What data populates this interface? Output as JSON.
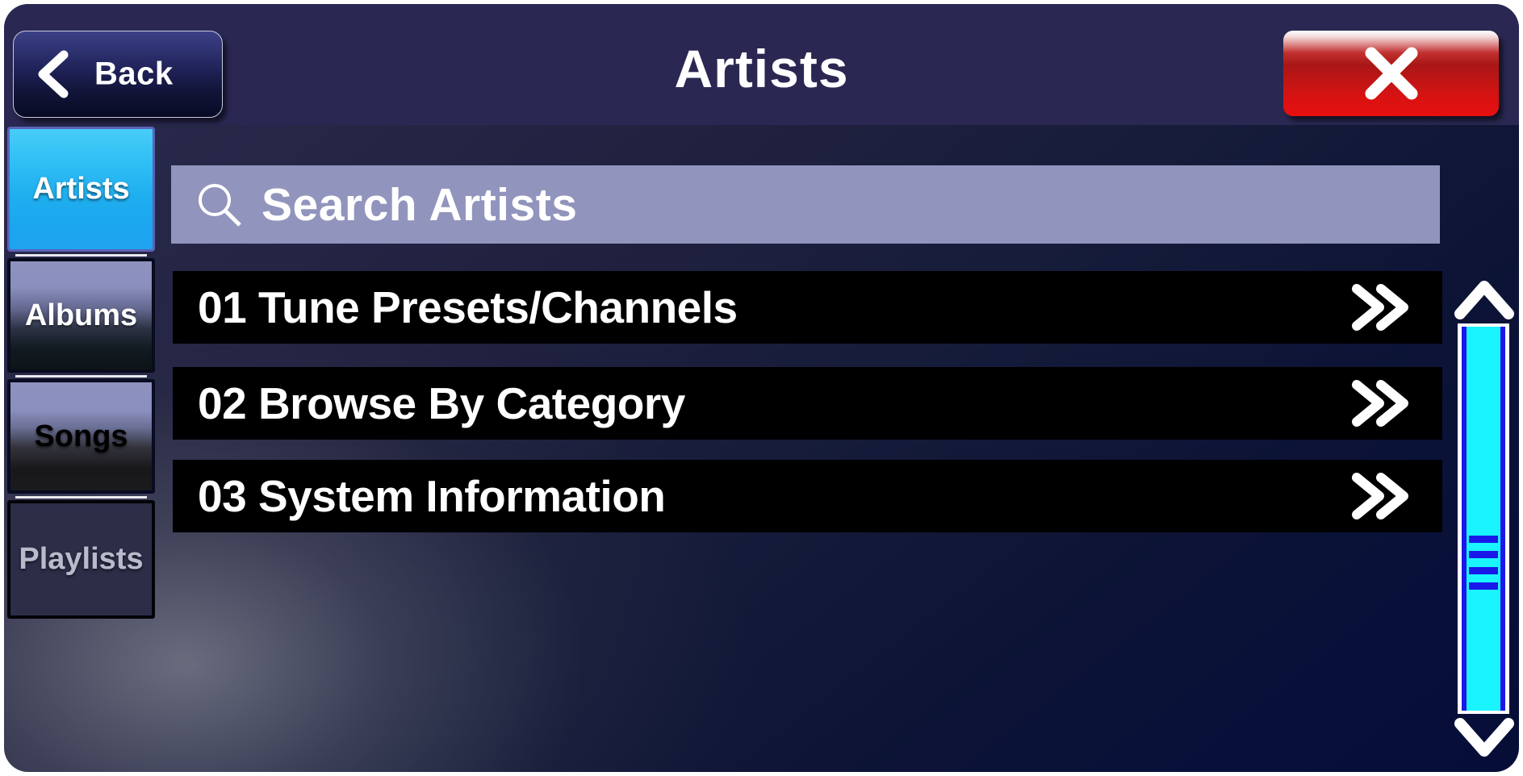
{
  "window": {
    "title": "Artists"
  },
  "header": {
    "back_label": "Back",
    "back_icon": "chevron-left-icon",
    "title": "Artists",
    "close_icon": "close-x-icon",
    "close_color": "#d91212"
  },
  "sidebar": {
    "items": [
      {
        "label": "Artists",
        "state": "active",
        "accent": "#1fafef"
      },
      {
        "label": "Albums",
        "state": "normal",
        "accent": "#8b8fbd"
      },
      {
        "label": "Songs",
        "state": "normal",
        "accent": "#8b8fbd"
      },
      {
        "label": "Playlists",
        "state": "disabled",
        "accent": "#2c2d47"
      }
    ]
  },
  "search": {
    "icon": "search-icon",
    "placeholder": "Search Artists",
    "value": "",
    "background": "#9195bd"
  },
  "list": {
    "rows": [
      {
        "label": "01 Tune Presets/Channels",
        "chevron": "double-chevron-right-icon"
      },
      {
        "label": "02 Browse By Category",
        "chevron": "double-chevron-right-icon"
      },
      {
        "label": "03 System Information",
        "chevron": "double-chevron-right-icon"
      }
    ]
  },
  "scrollbar": {
    "up_icon": "chevron-up-icon",
    "down_icon": "chevron-down-icon",
    "thumb_color": "#19f4ff",
    "rail_color": "#1a18e8",
    "grip_lines": 4
  }
}
